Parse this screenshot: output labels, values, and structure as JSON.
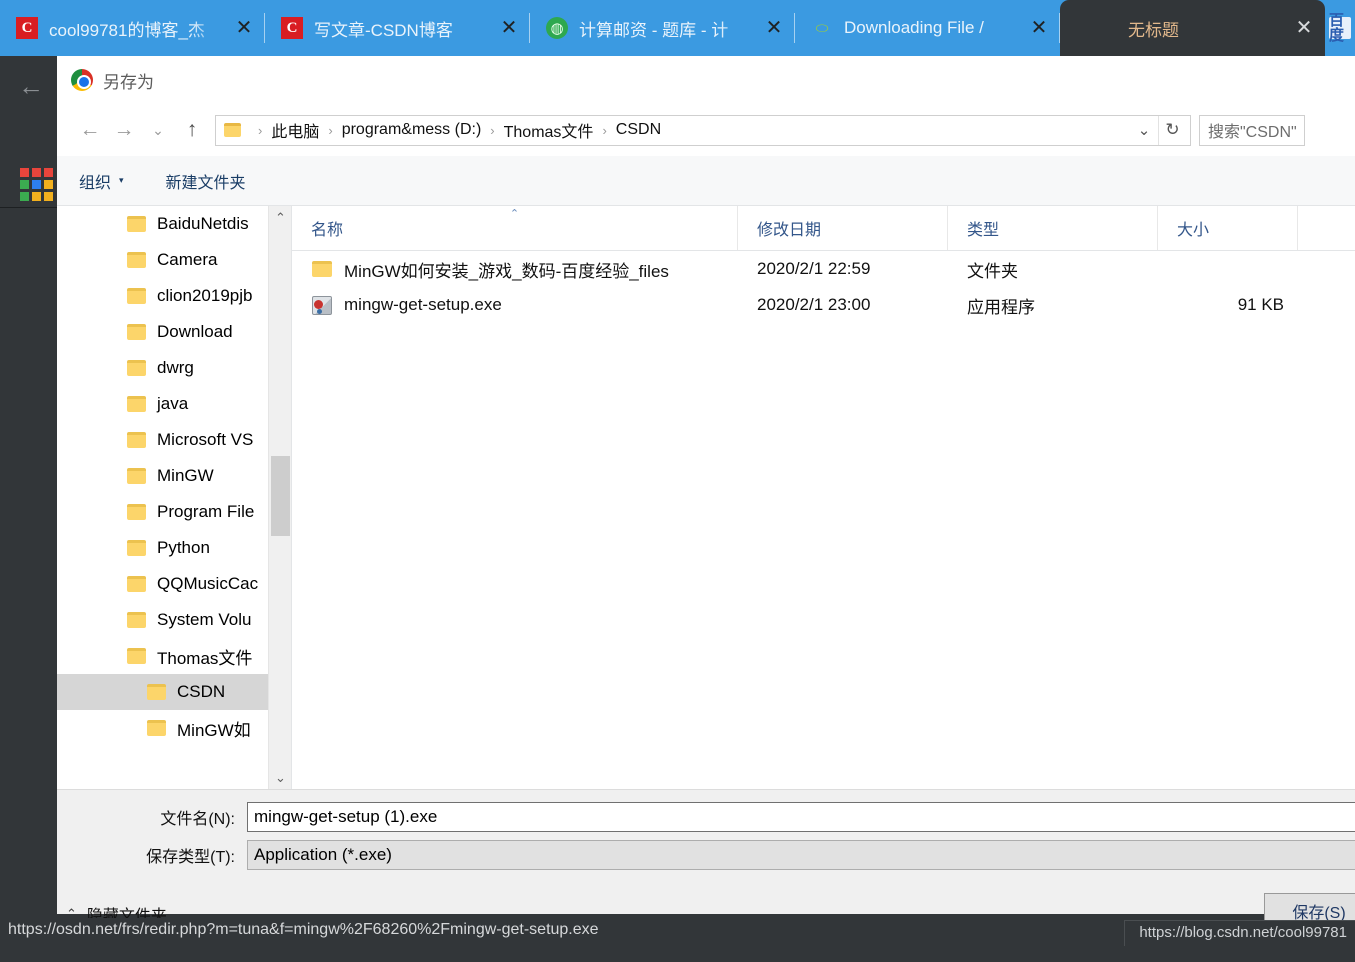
{
  "browser": {
    "tabs": [
      {
        "title": "cool99781的博客_杰",
        "favicon": "csdn-icon",
        "active": false,
        "close_label": "✕"
      },
      {
        "title": "写文章-CSDN博客",
        "favicon": "csdn-icon",
        "active": false,
        "close_label": "✕"
      },
      {
        "title": "计算邮资 - 题库 - 计",
        "favicon": "green-circle-icon",
        "active": false,
        "close_label": "✕"
      },
      {
        "title": "Downloading File /",
        "favicon": "osdn-ring-icon",
        "active": false,
        "close_label": "✕"
      },
      {
        "title": "无标题",
        "favicon": "none",
        "active": true,
        "close_label": "✕"
      }
    ],
    "partial_tab": {
      "favicon_label": "百度"
    },
    "back_arrow": "←",
    "status_url": "https://osdn.net/frs/redir.php?m=tuna&f=mingw%2F68260%2Fmingw-get-setup.exe",
    "status_right": "https://blog.csdn.net/cool99781",
    "tabstrip_color": "#3b9ae1",
    "chrome_dark": "#323639"
  },
  "dialog": {
    "title": "另存为",
    "nav": {
      "back": "←",
      "forward": "→",
      "recent": "⌄",
      "up": "↑",
      "dropdown": "⌄",
      "refresh": "↻"
    },
    "breadcrumbs": [
      "此电脑",
      "program&mess (D:)",
      "Thomas文件",
      "CSDN"
    ],
    "breadcrumb_sep": "›",
    "search": {
      "value": "搜索\"CSDN\""
    },
    "toolbar": {
      "organize_label": "组织",
      "organize_caret": "▾",
      "newfolder_label": "新建文件夹"
    },
    "tree": [
      {
        "label": "BaiduNetdis",
        "indent": 1,
        "selected": false
      },
      {
        "label": "Camera",
        "indent": 1,
        "selected": false
      },
      {
        "label": "clion2019pjb",
        "indent": 1,
        "selected": false
      },
      {
        "label": "Download",
        "indent": 1,
        "selected": false
      },
      {
        "label": "dwrg",
        "indent": 1,
        "selected": false
      },
      {
        "label": "java",
        "indent": 1,
        "selected": false
      },
      {
        "label": "Microsoft VS",
        "indent": 1,
        "selected": false
      },
      {
        "label": "MinGW",
        "indent": 1,
        "selected": false
      },
      {
        "label": "Program File",
        "indent": 1,
        "selected": false
      },
      {
        "label": "Python",
        "indent": 1,
        "selected": false
      },
      {
        "label": "QQMusicCac",
        "indent": 1,
        "selected": false
      },
      {
        "label": "System Volu",
        "indent": 1,
        "selected": false
      },
      {
        "label": "Thomas文件",
        "indent": 1,
        "selected": false
      },
      {
        "label": "CSDN",
        "indent": 2,
        "selected": true
      },
      {
        "label": "MinGW如",
        "indent": 2,
        "selected": false
      }
    ],
    "scrollbar": {
      "up": "⌃",
      "down": "⌄"
    },
    "columns": [
      {
        "key": "name",
        "label": "名称",
        "sorted": "asc",
        "sortmark": "⌃"
      },
      {
        "key": "date",
        "label": "修改日期",
        "sorted": "",
        "sortmark": ""
      },
      {
        "key": "type",
        "label": "类型",
        "sorted": "",
        "sortmark": ""
      },
      {
        "key": "size",
        "label": "大小",
        "sorted": "",
        "sortmark": ""
      }
    ],
    "files": [
      {
        "name": "MinGW如何安装_游戏_数码-百度经验_files",
        "date": "2020/2/1 22:59",
        "type": "文件夹",
        "size": "",
        "icon": "folder-icon"
      },
      {
        "name": "mingw-get-setup.exe",
        "date": "2020/2/1 23:00",
        "type": "应用程序",
        "size": "91 KB",
        "icon": "exe-icon"
      }
    ],
    "form": {
      "filename_label": "文件名(N):",
      "filename_value": "mingw-get-setup (1).exe",
      "filetype_label": "保存类型(T):",
      "filetype_value": "Application (*.exe)",
      "filetype_caret": "⌄",
      "hide_folders_label": "隐藏文件夹",
      "hide_folders_chevron": "⌃",
      "save_label": "保存(S)"
    }
  }
}
